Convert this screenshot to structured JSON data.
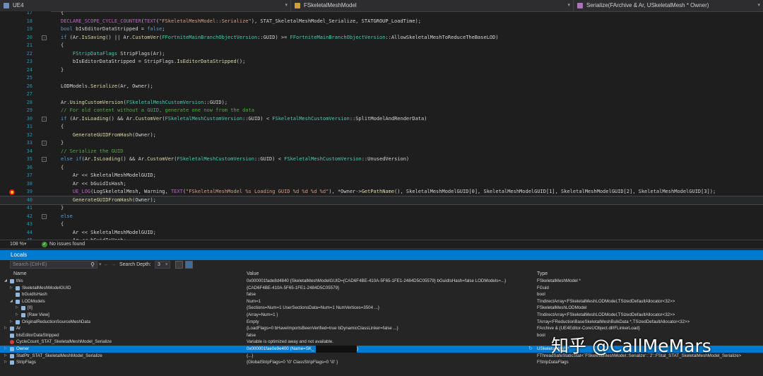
{
  "topbar": {
    "project": "UE4",
    "class_dropdown": "FSkeletalMeshModel",
    "member_dropdown": "Serialize(FArchive & Ar, USkeletalMesh * Owner)"
  },
  "editor": {
    "lines": [
      {
        "num": "17",
        "code": [
          {
            "t": "{",
            "c": ""
          }
        ]
      },
      {
        "num": "18",
        "code": [
          {
            "t": "DECLARE_SCOPE_CYCLE_COUNTER",
            "c": "m"
          },
          {
            "t": "(",
            "c": ""
          },
          {
            "t": "TEXT",
            "c": "m"
          },
          {
            "t": "(",
            "c": ""
          },
          {
            "t": "\"FSkeletalMeshModel::Serialize\"",
            "c": "s"
          },
          {
            "t": "), STAT_SkeletalMeshModel_Serialize, STATGROUP_LoadTime);",
            "c": ""
          }
        ]
      },
      {
        "num": "19",
        "code": [
          {
            "t": "bool",
            "c": "k"
          },
          {
            "t": " bIsEditorDataStripped = ",
            "c": ""
          },
          {
            "t": "false",
            "c": "k"
          },
          {
            "t": ";",
            "c": ""
          }
        ]
      },
      {
        "num": "20",
        "fold": "-",
        "code": [
          {
            "t": "if",
            "c": "k"
          },
          {
            "t": " (Ar.",
            "c": ""
          },
          {
            "t": "IsSaving",
            "c": "f"
          },
          {
            "t": "() || Ar.",
            "c": ""
          },
          {
            "t": "CustomVer",
            "c": "f"
          },
          {
            "t": "(",
            "c": ""
          },
          {
            "t": "FFortniteMainBranchObjectVersion",
            "c": "t"
          },
          {
            "t": "::GUID) >= ",
            "c": ""
          },
          {
            "t": "FFortniteMainBranchObjectVersion",
            "c": "t"
          },
          {
            "t": "::AllowSkeletalMeshToReduceTheBaseLOD)",
            "c": ""
          }
        ]
      },
      {
        "num": "21",
        "code": [
          {
            "t": "{",
            "c": ""
          }
        ]
      },
      {
        "num": "22",
        "code": [
          {
            "t": "    FStripDataFlags",
            "c": "t"
          },
          {
            "t": " StripFlags(Ar);",
            "c": ""
          }
        ]
      },
      {
        "num": "23",
        "code": [
          {
            "t": "    bIsEditorDataStripped = StripFlags.",
            "c": ""
          },
          {
            "t": "IsEditorDataStripped",
            "c": "f"
          },
          {
            "t": "();",
            "c": ""
          }
        ]
      },
      {
        "num": "24",
        "code": [
          {
            "t": "}",
            "c": ""
          }
        ]
      },
      {
        "num": "25",
        "code": []
      },
      {
        "num": "26",
        "code": [
          {
            "t": "LODModels.",
            "c": ""
          },
          {
            "t": "Serialize",
            "c": "f"
          },
          {
            "t": "(Ar, Owner);",
            "c": ""
          }
        ]
      },
      {
        "num": "27",
        "code": []
      },
      {
        "num": "28",
        "code": [
          {
            "t": "Ar.",
            "c": ""
          },
          {
            "t": "UsingCustomVersion",
            "c": "f"
          },
          {
            "t": "(",
            "c": ""
          },
          {
            "t": "FSkeletalMeshCustomVersion",
            "c": "t"
          },
          {
            "t": "::GUID);",
            "c": ""
          }
        ]
      },
      {
        "num": "29",
        "code": [
          {
            "t": "// For old content without a GUID, generate one now from the data",
            "c": "c"
          }
        ]
      },
      {
        "num": "30",
        "fold": "-",
        "code": [
          {
            "t": "if",
            "c": "k"
          },
          {
            "t": " (Ar.",
            "c": ""
          },
          {
            "t": "IsLoading",
            "c": "f"
          },
          {
            "t": "() && Ar.",
            "c": ""
          },
          {
            "t": "CustomVer",
            "c": "f"
          },
          {
            "t": "(",
            "c": ""
          },
          {
            "t": "FSkeletalMeshCustomVersion",
            "c": "t"
          },
          {
            "t": "::GUID) < ",
            "c": ""
          },
          {
            "t": "FSkeletalMeshCustomVersion",
            "c": "t"
          },
          {
            "t": "::SplitModelAndRenderData)",
            "c": ""
          }
        ]
      },
      {
        "num": "31",
        "code": [
          {
            "t": "{",
            "c": ""
          }
        ]
      },
      {
        "num": "32",
        "code": [
          {
            "t": "    ",
            "c": ""
          },
          {
            "t": "GenerateGUIDFromHash",
            "c": "f"
          },
          {
            "t": "(Owner);",
            "c": ""
          }
        ]
      },
      {
        "num": "33",
        "fold": "-",
        "code": [
          {
            "t": "}",
            "c": ""
          }
        ]
      },
      {
        "num": "34",
        "code": [
          {
            "t": "// Serialize the GUID",
            "c": "c"
          }
        ]
      },
      {
        "num": "35",
        "fold": "-",
        "code": [
          {
            "t": "else if",
            "c": "k"
          },
          {
            "t": "(Ar.",
            "c": ""
          },
          {
            "t": "IsLoading",
            "c": "f"
          },
          {
            "t": "() && Ar.",
            "c": ""
          },
          {
            "t": "CustomVer",
            "c": "f"
          },
          {
            "t": "(",
            "c": ""
          },
          {
            "t": "FSkeletalMeshCustomVersion",
            "c": "t"
          },
          {
            "t": "::GUID) < ",
            "c": ""
          },
          {
            "t": "FSkeletalMeshCustomVersion",
            "c": "t"
          },
          {
            "t": "::UnusedVersion)",
            "c": ""
          }
        ]
      },
      {
        "num": "36",
        "code": [
          {
            "t": "{",
            "c": ""
          }
        ]
      },
      {
        "num": "37",
        "code": [
          {
            "t": "    Ar << SkeletalMeshModelGUID;",
            "c": ""
          }
        ]
      },
      {
        "num": "38",
        "code": [
          {
            "t": "    Ar << bGuidIsHash;",
            "c": ""
          }
        ]
      },
      {
        "num": "39",
        "bp": true,
        "code": [
          {
            "t": "    ",
            "c": ""
          },
          {
            "t": "UE_LOG",
            "c": "m"
          },
          {
            "t": "(LogSkeletalMesh, Warning, ",
            "c": ""
          },
          {
            "t": "TEXT",
            "c": "m"
          },
          {
            "t": "(",
            "c": ""
          },
          {
            "t": "\"FSkeletalMeshModel %s Loading GUID %d %d %d %d\"",
            "c": "s"
          },
          {
            "t": "), *Owner->",
            "c": ""
          },
          {
            "t": "GetPathName",
            "c": "f"
          },
          {
            "t": "(), SkeletalMeshModelGUID[0], SkeletalMeshModelGUID[1], SkeletalMeshModelGUID[2], SkeletalMeshModelGUID[3]);",
            "c": ""
          }
        ]
      },
      {
        "num": "40",
        "hl": true,
        "code": [
          {
            "t": "    ",
            "c": ""
          },
          {
            "t": "GenerateGUIDFromHash",
            "c": "f"
          },
          {
            "t": "(Owner);",
            "c": ""
          }
        ]
      },
      {
        "num": "41",
        "code": [
          {
            "t": "}",
            "c": ""
          }
        ]
      },
      {
        "num": "42",
        "fold": "-",
        "code": [
          {
            "t": "else",
            "c": "k"
          }
        ]
      },
      {
        "num": "43",
        "code": [
          {
            "t": "{",
            "c": ""
          }
        ]
      },
      {
        "num": "44",
        "code": [
          {
            "t": "    Ar << SkeletalMeshModelGUID;",
            "c": ""
          }
        ]
      },
      {
        "num": "45",
        "code": [
          {
            "t": "    Ar << bGuidIsHash;",
            "c": ""
          }
        ]
      },
      {
        "num": "46",
        "code": [
          {
            "t": "}",
            "c": ""
          }
        ]
      },
      {
        "num": "47",
        "code": []
      },
      {
        "num": "48",
        "code": [
          {
            "t": "if",
            "c": "k"
          },
          {
            "t": " (!bIsEditorDataStripped)",
            "c": ""
          }
        ]
      }
    ]
  },
  "status": {
    "zoom": "108 %",
    "issues": "No issues found"
  },
  "locals": {
    "title": "Locals",
    "search_placeholder": "Search (Ctrl+E)",
    "search_depth_label": "Search Depth:",
    "search_depth_value": "3",
    "columns": {
      "name": "Name",
      "value": "Value",
      "type": "Type"
    },
    "rows": [
      {
        "indent": 1,
        "expand": "open",
        "icon": "var",
        "name": "this",
        "value": "0x000001fade8d4840 {SkeletalMeshModelGUID={CAD6F4BE-410A-5F65-1FE1-2484D5C05579} bGuidIsHash=false LODModels=...}",
        "type": "FSkeletalMeshModel *"
      },
      {
        "indent": 2,
        "expand": "closed",
        "icon": "var",
        "name": "SkeletalMeshModelGUID",
        "value": "{CAD6F4BE-410A-5F65-1FE1-2484D5C05579}",
        "type": "FGuid"
      },
      {
        "indent": 2,
        "expand": "",
        "icon": "var",
        "name": "bGuidIsHash",
        "value": "false",
        "type": "bool"
      },
      {
        "indent": 2,
        "expand": "open",
        "icon": "var",
        "name": "LODModels",
        "value": "Num=1",
        "type": "TIndirectArray<FSkeletalMeshLODModel,TSizedDefaultAllocator<32>>"
      },
      {
        "indent": 3,
        "expand": "closed",
        "icon": "var",
        "name": "[0]",
        "value": "{Sections=Num=1 UserSectionsData=Num=1 NumVertices=3504 ...}",
        "type": "FSkeletalMeshLODModel"
      },
      {
        "indent": 3,
        "expand": "closed",
        "icon": "var",
        "name": "[Raw View]",
        "value": "{Array=Num=1 }",
        "type": "TIndirectArray<FSkeletalMeshLODModel,TSizedDefaultAllocator<32>>"
      },
      {
        "indent": 2,
        "expand": "closed",
        "icon": "var",
        "name": "OriginalReductionSourceMeshData",
        "value": "Empty",
        "type": "TArray<FReductionBaseSkeletalMeshBulkData *,TSizedDefaultAllocator<32>>"
      },
      {
        "indent": 1,
        "expand": "closed",
        "icon": "var",
        "name": "Ar",
        "value": "{LoadFlags=0 bHaveImportsBeenVerified=true bDynamicClassLinker=false ...}",
        "type": "FArchive & {UE4Editor-CoreUObject.dll!FLinkerLoad}"
      },
      {
        "indent": 1,
        "expand": "",
        "icon": "var",
        "name": "bIsEditorDataStripped",
        "value": "false",
        "type": "bool"
      },
      {
        "indent": 1,
        "expand": "",
        "icon": "err",
        "name": "CycleCount_STAT_SkeletalMeshModel_Serialize",
        "value": "Variable is optimized away and not available.",
        "type": ""
      },
      {
        "indent": 1,
        "expand": "closed",
        "icon": "var",
        "name": "Owner",
        "value": "0x000001fae0e9e400 (Name=SK_",
        "value_tail": ")",
        "type": "USkeletalMesh *",
        "selected": true,
        "redacted": true
      },
      {
        "indent": 1,
        "expand": "closed",
        "icon": "var",
        "name": "StatPtr_STAT_SkeletalMeshModel_Serialize",
        "value": "{...}",
        "type": "FThreadSafeStaticStat<`FSkeletalMeshModel::Serialize'::`2'::FStat_STAT_SkeletalMeshModel_Serialize>"
      },
      {
        "indent": 1,
        "expand": "closed",
        "icon": "var",
        "name": "StripFlags",
        "value": "{GlobalStripFlags=0 '\\0' ClassStripFlags=0 '\\0' }",
        "type": "FStripDataFlags"
      }
    ]
  },
  "watermark": "知乎 @CallMeMars"
}
